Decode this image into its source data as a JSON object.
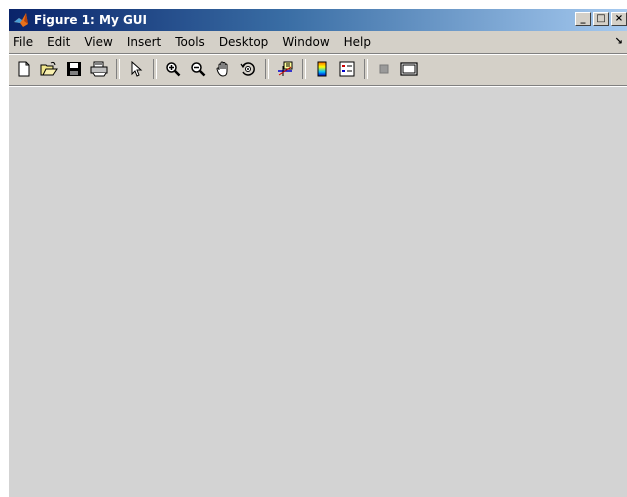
{
  "window": {
    "title": "Figure 1: My GUI",
    "controls": {
      "minimize": "_",
      "maximize": "□",
      "close": "×"
    }
  },
  "menubar": {
    "items": [
      "File",
      "Edit",
      "View",
      "Insert",
      "Tools",
      "Desktop",
      "Window",
      "Help"
    ],
    "dock_arrow": "↘"
  },
  "toolbar": {
    "buttons": [
      {
        "name": "new-figure-icon"
      },
      {
        "name": "open-file-icon"
      },
      {
        "name": "save-figure-icon"
      },
      {
        "name": "print-figure-icon"
      },
      {
        "name": "edit-plot-arrow-icon"
      },
      {
        "name": "zoom-in-icon"
      },
      {
        "name": "zoom-out-icon"
      },
      {
        "name": "pan-hand-icon"
      },
      {
        "name": "rotate-3d-icon"
      },
      {
        "name": "data-cursor-icon"
      },
      {
        "name": "insert-colorbar-icon"
      },
      {
        "name": "insert-legend-icon"
      },
      {
        "name": "hide-plot-tools-icon"
      },
      {
        "name": "show-plot-tools-icon"
      }
    ]
  },
  "colors": {
    "title_gradient_start": "#0a246a",
    "title_gradient_end": "#a6caf0",
    "chrome": "#d4d0c8",
    "canvas": "#d3d3d3"
  }
}
